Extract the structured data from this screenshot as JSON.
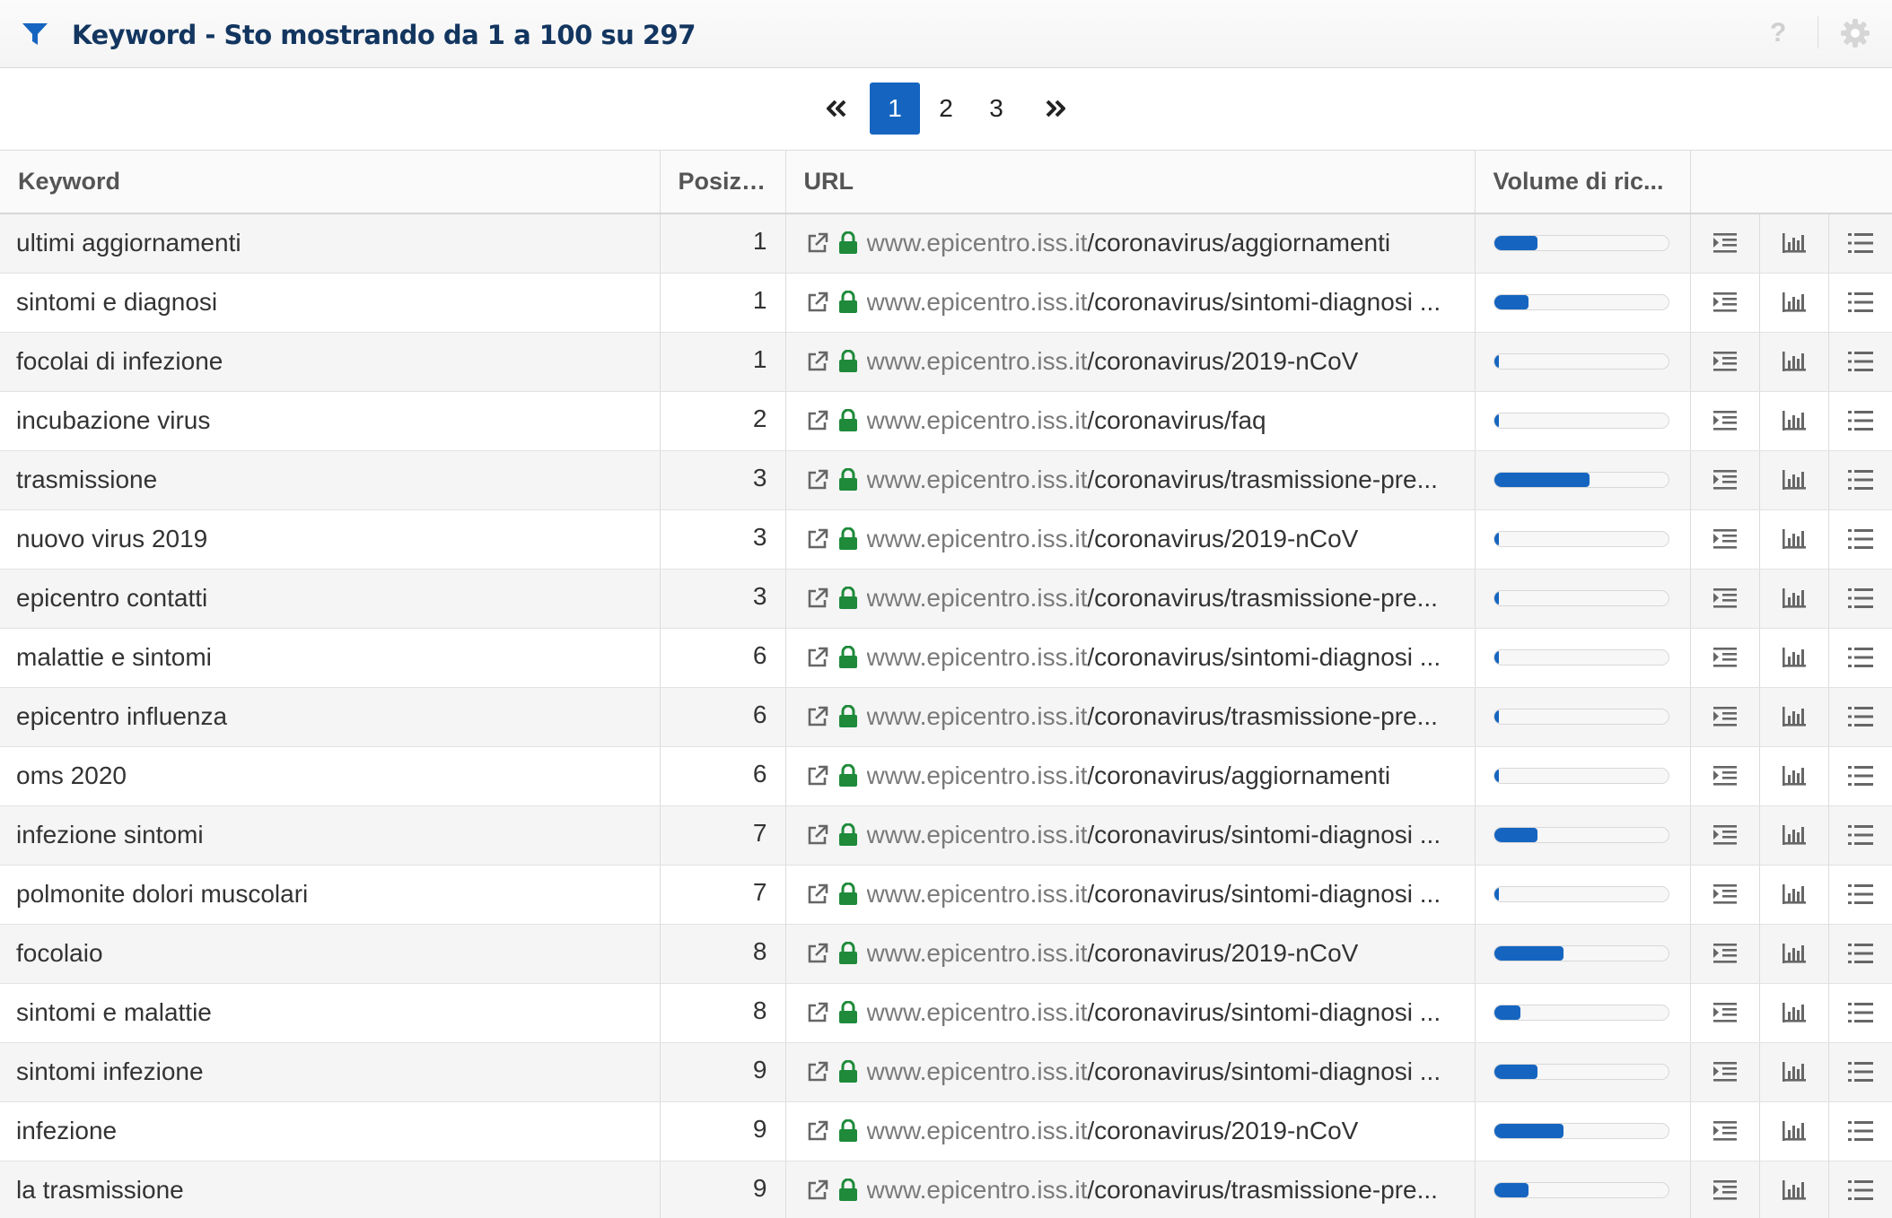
{
  "header": {
    "title": "Keyword - Sto mostrando da 1 a 100 su 297",
    "help": "?"
  },
  "pagination": {
    "first": "«",
    "pages": [
      "1",
      "2",
      "3"
    ],
    "active": "1",
    "last": "»"
  },
  "columns": {
    "keyword": "Keyword",
    "position": "Posizi...",
    "url": "URL",
    "volume": "Volume di ric..."
  },
  "colors": {
    "accent": "#1565c0",
    "lock": "#1e8a3a",
    "title": "#133660"
  },
  "rows": [
    {
      "keyword": "ultimi aggiornamenti",
      "position": "1",
      "host": "www.epicentro.iss.it",
      "path": "/coronavirus/aggiornamenti",
      "volume": 0.25
    },
    {
      "keyword": "sintomi e diagnosi",
      "position": "1",
      "host": "www.epicentro.iss.it",
      "path": "/coronavirus/sintomi-diagnosi ...",
      "volume": 0.2
    },
    {
      "keyword": "focolai di infezione",
      "position": "1",
      "host": "www.epicentro.iss.it",
      "path": "/coronavirus/2019-nCoV",
      "volume": 0.03
    },
    {
      "keyword": "incubazione virus",
      "position": "2",
      "host": "www.epicentro.iss.it",
      "path": "/coronavirus/faq",
      "volume": 0.03
    },
    {
      "keyword": "trasmissione",
      "position": "3",
      "host": "www.epicentro.iss.it",
      "path": "/coronavirus/trasmissione-pre...",
      "volume": 0.55
    },
    {
      "keyword": "nuovo virus 2019",
      "position": "3",
      "host": "www.epicentro.iss.it",
      "path": "/coronavirus/2019-nCoV",
      "volume": 0.03
    },
    {
      "keyword": "epicentro contatti",
      "position": "3",
      "host": "www.epicentro.iss.it",
      "path": "/coronavirus/trasmissione-pre...",
      "volume": 0.03
    },
    {
      "keyword": "malattie e sintomi",
      "position": "6",
      "host": "www.epicentro.iss.it",
      "path": "/coronavirus/sintomi-diagnosi ...",
      "volume": 0.03
    },
    {
      "keyword": "epicentro influenza",
      "position": "6",
      "host": "www.epicentro.iss.it",
      "path": "/coronavirus/trasmissione-pre...",
      "volume": 0.03
    },
    {
      "keyword": "oms 2020",
      "position": "6",
      "host": "www.epicentro.iss.it",
      "path": "/coronavirus/aggiornamenti",
      "volume": 0.03
    },
    {
      "keyword": "infezione sintomi",
      "position": "7",
      "host": "www.epicentro.iss.it",
      "path": "/coronavirus/sintomi-diagnosi ...",
      "volume": 0.25
    },
    {
      "keyword": "polmonite dolori muscolari",
      "position": "7",
      "host": "www.epicentro.iss.it",
      "path": "/coronavirus/sintomi-diagnosi ...",
      "volume": 0.03
    },
    {
      "keyword": "focolaio",
      "position": "8",
      "host": "www.epicentro.iss.it",
      "path": "/coronavirus/2019-nCoV",
      "volume": 0.4
    },
    {
      "keyword": "sintomi e malattie",
      "position": "8",
      "host": "www.epicentro.iss.it",
      "path": "/coronavirus/sintomi-diagnosi ...",
      "volume": 0.15
    },
    {
      "keyword": "sintomi infezione",
      "position": "9",
      "host": "www.epicentro.iss.it",
      "path": "/coronavirus/sintomi-diagnosi ...",
      "volume": 0.25
    },
    {
      "keyword": "infezione",
      "position": "9",
      "host": "www.epicentro.iss.it",
      "path": "/coronavirus/2019-nCoV",
      "volume": 0.4
    },
    {
      "keyword": "la trasmissione",
      "position": "9",
      "host": "www.epicentro.iss.it",
      "path": "/coronavirus/trasmissione-pre...",
      "volume": 0.2
    }
  ]
}
